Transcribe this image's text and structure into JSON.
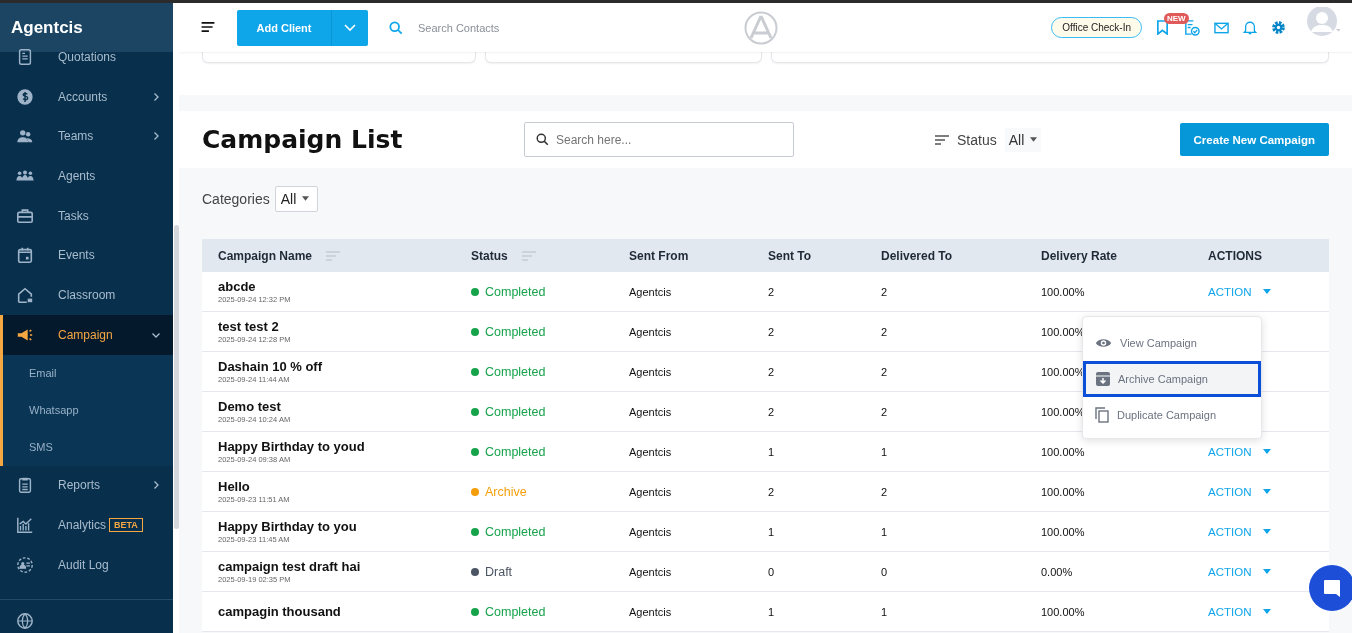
{
  "brand": "Agentcis",
  "sidebar": {
    "items": [
      {
        "label": "Quotations",
        "selected": false
      },
      {
        "label": "Accounts",
        "selected": false,
        "expanded": false
      },
      {
        "label": "Teams",
        "selected": false,
        "expanded": false
      },
      {
        "label": "Agents",
        "selected": false
      },
      {
        "label": "Tasks",
        "selected": false
      },
      {
        "label": "Events",
        "selected": false
      },
      {
        "label": "Classroom",
        "selected": false
      },
      {
        "label": "Campaign",
        "selected": true,
        "expanded": true,
        "children": [
          {
            "label": "Email",
            "selected": false
          },
          {
            "label": "Whatsapp",
            "selected": false
          },
          {
            "label": "SMS",
            "selected": false
          }
        ]
      },
      {
        "label": "Reports",
        "selected": false,
        "expanded": false
      },
      {
        "label": "Analytics",
        "selected": false,
        "badge": "BETA"
      },
      {
        "label": "Audit Log",
        "selected": false
      }
    ]
  },
  "header": {
    "add_client": "Add Client",
    "search_placeholder": "Search Contacts",
    "office_checkin": "Office Check-In",
    "new_badge": "NEW"
  },
  "page": {
    "title": "Campaign List",
    "search_placeholder": "Search here...",
    "status_label": "Status",
    "status_value": "All",
    "create_button": "Create New Campaign",
    "categories_label": "Categories",
    "categories_value": "All"
  },
  "table": {
    "columns": [
      {
        "label": "Campaign Name",
        "sortable": true
      },
      {
        "label": "Status",
        "sortable": true
      },
      {
        "label": "Sent From",
        "sortable": false
      },
      {
        "label": "Sent To",
        "sortable": false
      },
      {
        "label": "Delivered To",
        "sortable": false
      },
      {
        "label": "Delivery Rate",
        "sortable": false
      },
      {
        "label": "ACTIONS",
        "sortable": false
      }
    ],
    "rows": [
      {
        "name": "abcde",
        "date": "2025-09-24 12:32 PM",
        "status": "Completed",
        "color": "#16a34a",
        "sent_from": "Agentcis",
        "sent_to": "2",
        "delivered_to": "2",
        "rate": "100.00%",
        "action": "ACTION"
      },
      {
        "name": "test test 2",
        "date": "2025-09-24 12:28 PM",
        "status": "Completed",
        "color": "#16a34a",
        "sent_from": "Agentcis",
        "sent_to": "2",
        "delivered_to": "2",
        "rate": "100.00%"
      },
      {
        "name": "Dashain 10 % off",
        "date": "2025-09-24 11:44 AM",
        "status": "Completed",
        "color": "#16a34a",
        "sent_from": "Agentcis",
        "sent_to": "2",
        "delivered_to": "2",
        "rate": "100.00%"
      },
      {
        "name": "Demo test",
        "date": "2025-09-24 10:24 AM",
        "status": "Completed",
        "color": "#16a34a",
        "sent_from": "Agentcis",
        "sent_to": "2",
        "delivered_to": "2",
        "rate": "100.00%"
      },
      {
        "name": "Happy Birthday to youd",
        "date": "2025-09-24 09:38 AM",
        "status": "Completed",
        "color": "#16a34a",
        "sent_from": "Agentcis",
        "sent_to": "1",
        "delivered_to": "1",
        "rate": "100.00%",
        "action": "ACTION"
      },
      {
        "name": "Hello",
        "date": "2025-09-23 11:51 AM",
        "status": "Archive",
        "color": "#f59e0b",
        "sent_from": "Agentcis",
        "sent_to": "2",
        "delivered_to": "2",
        "rate": "100.00%",
        "action": "ACTION"
      },
      {
        "name": "Happy Birthday to you",
        "date": "2025-09-23 11:45 AM",
        "status": "Completed",
        "color": "#16a34a",
        "sent_from": "Agentcis",
        "sent_to": "1",
        "delivered_to": "1",
        "rate": "100.00%",
        "action": "ACTION"
      },
      {
        "name": "campaign test draft hai",
        "date": "2025-09-19 02:35 PM",
        "status": "Draft",
        "color": "#4b5563",
        "sent_from": "Agentcis",
        "sent_to": "0",
        "delivered_to": "0",
        "rate": "0.00%",
        "action": "ACTION"
      },
      {
        "name": "campagin thousand",
        "status": "Completed",
        "color": "#16a34a",
        "sent_from": "Agentcis",
        "sent_to": "1",
        "delivered_to": "1",
        "rate": "100.00%",
        "action": "ACTION"
      }
    ]
  },
  "action_menu": {
    "items": [
      {
        "label": "View Campaign",
        "selected": false
      },
      {
        "label": "Archive Campaign",
        "selected": true
      },
      {
        "label": "Duplicate Campaign",
        "selected": false
      }
    ]
  }
}
